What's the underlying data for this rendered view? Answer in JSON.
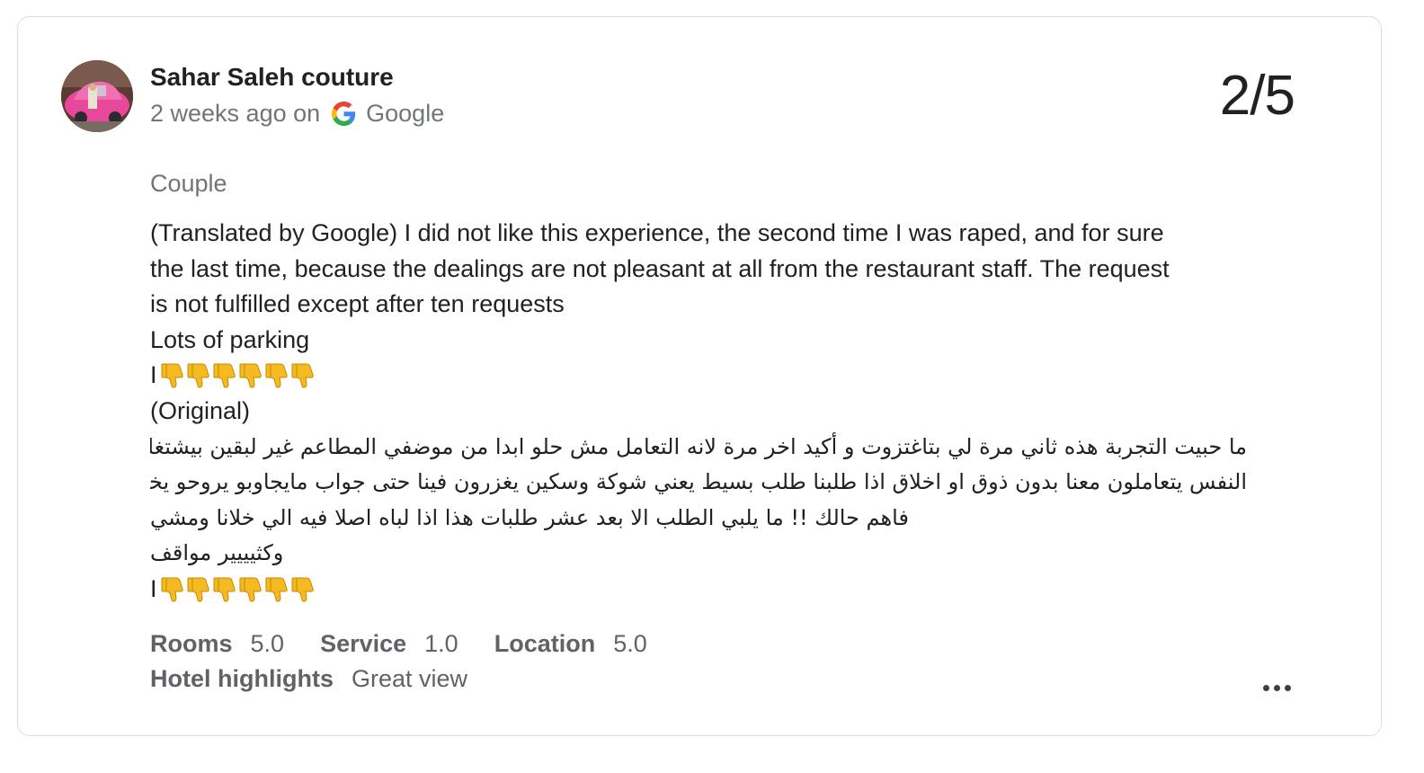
{
  "review": {
    "author_name": "Sahar Saleh couture",
    "time_ago": "2 weeks ago on",
    "source": "Google",
    "rating": "2/5",
    "trip_type": "Couple",
    "text_lines": [
      "(Translated by Google) I did not like this experience, the second time I was raped, and for sure",
      "the last time, because the dealings are not pleasant at all from the restaurant staff. The request",
      "is not fulfilled except after ten requests",
      "Lots of parking"
    ],
    "pipe_char": "I",
    "original_label": "(Original)",
    "original_lines": [
      "ما حبيت التجربة هذه ثاني مرة لي بتاغتزوت و أكيد اخر مرة لانه التعامل مش حلو ابدا من موضفي المطاعم غير لبقين بيشتغلو فوق",
      "النفس يتعاملون معنا بدون ذوق او اخلاق اذا طلبنا طلب بسيط يعني شوكة وسكين يغزرون فينا حتى جواب مايجاوبو يروحو يخليك مش",
      "فاهم حالك !! ما يلبي الطلب الا بعد عشر طلبات هذا اذا لباه اصلا فيه الي خلانا ومشي",
      "وكثيييير مواقف"
    ],
    "thumbs_count": 6,
    "thumb_icon": "thumbs-down-emoji",
    "ratings": [
      {
        "label": "Rooms",
        "value": "5.0"
      },
      {
        "label": "Service",
        "value": "1.0"
      },
      {
        "label": "Location",
        "value": "5.0"
      }
    ],
    "highlights_label": "Hotel highlights",
    "highlights_value": "Great view",
    "more_icon": "more-horiz-icon"
  },
  "colors": {
    "text_primary": "#202124",
    "text_secondary": "#70757a",
    "label_gray": "#5f6368",
    "border": "#dadce0",
    "emoji_yellow": "#f5b921"
  }
}
